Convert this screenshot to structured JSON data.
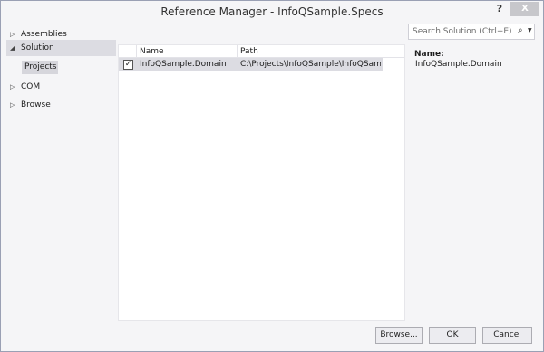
{
  "window": {
    "title": "Reference Manager - InfoQSample.Specs",
    "help_label": "?",
    "close_label": "X"
  },
  "sidebar": {
    "items": [
      {
        "label": "Assemblies",
        "arrow": "▷"
      },
      {
        "label": "Solution",
        "arrow": "◢"
      },
      {
        "label": "COM",
        "arrow": "▷"
      },
      {
        "label": "Browse",
        "arrow": "▷"
      }
    ],
    "sub_item": "Projects"
  },
  "search": {
    "placeholder": "Search Solution (Ctrl+E)",
    "icon": "search-icon"
  },
  "grid": {
    "columns": [
      "Name",
      "Path"
    ],
    "rows": [
      {
        "checked": true,
        "name": "InfoQSample.Domain",
        "path": "C:\\Projects\\InfoQSample\\InfoQSample.Do..."
      }
    ]
  },
  "details": {
    "label": "Name:",
    "value": "InfoQSample.Domain"
  },
  "footer": {
    "browse_label": "Browse...",
    "ok_label": "OK",
    "cancel_label": "Cancel"
  }
}
